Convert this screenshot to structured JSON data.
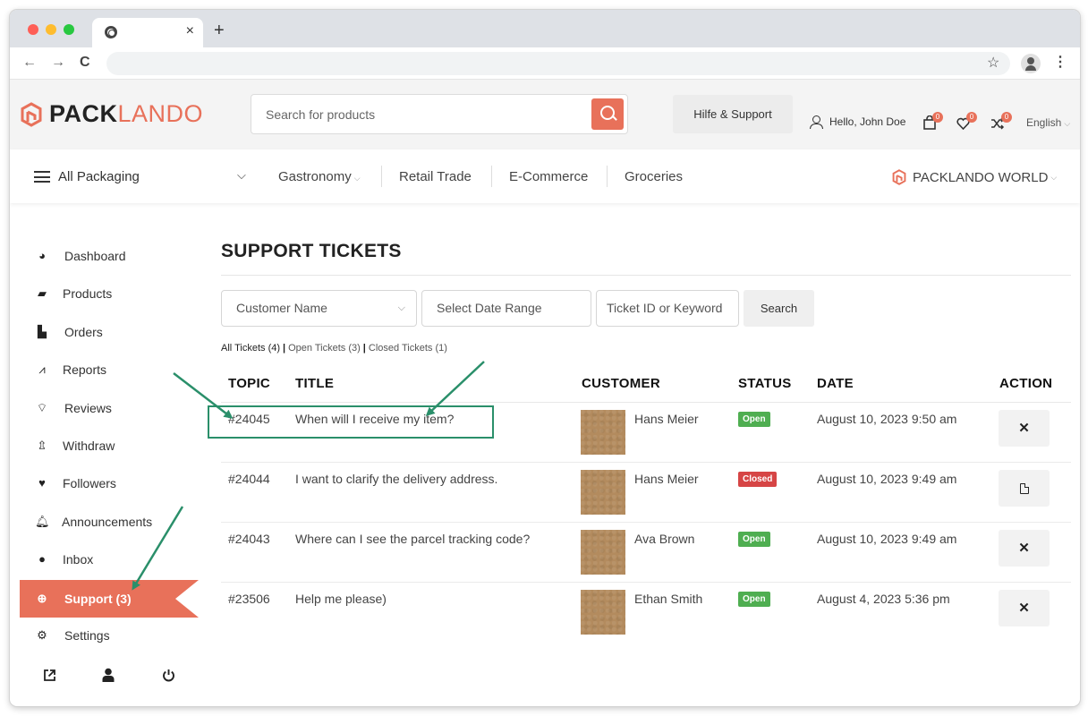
{
  "browser": {
    "tab_close": "×",
    "new_tab": "+",
    "back": "←",
    "forward": "→",
    "reload": "C",
    "bookmark_star": "☆",
    "menu": "⋮"
  },
  "header": {
    "logo_pack": "PACK",
    "logo_lando": "LANDO",
    "search_placeholder": "Search for products",
    "help_label": "Hilfe & Support",
    "user_greeting": "Hello, John Doe",
    "cart_count": "0",
    "wishlist_count": "0",
    "compare_count": "0",
    "language": "English",
    "brand_color": "#e8715a"
  },
  "catbar": {
    "all_label": "All Packaging",
    "categories": [
      "Gastronomy",
      "Retail Trade",
      "E-Commerce",
      "Groceries"
    ],
    "world_label": "PACKLANDO WORLD"
  },
  "sidebar": {
    "items": [
      {
        "label": "Dashboard",
        "icon": "gauge-icon"
      },
      {
        "label": "Products",
        "icon": "briefcase-icon"
      },
      {
        "label": "Orders",
        "icon": "cart-icon"
      },
      {
        "label": "Reports",
        "icon": "chart-icon"
      },
      {
        "label": "Reviews",
        "icon": "comments-icon"
      },
      {
        "label": "Withdraw",
        "icon": "upload-icon"
      },
      {
        "label": "Followers",
        "icon": "heart-icon"
      },
      {
        "label": "Announcements",
        "icon": "bell-icon"
      },
      {
        "label": "Inbox",
        "icon": "chat-icon"
      },
      {
        "label": "Support (3)",
        "icon": "lifebuoy-icon",
        "active": true
      },
      {
        "label": "Settings",
        "icon": "gear-icon"
      }
    ]
  },
  "main": {
    "title": "SUPPORT TICKETS",
    "filters": {
      "customer": "Customer Name",
      "date_range": "Select Date Range",
      "keyword": "Ticket ID or Keyword",
      "search_btn": "Search"
    },
    "ticket_tabs": {
      "all": "All Tickets (4)",
      "open": "Open Tickets (3)",
      "closed": "Closed Tickets (1)"
    },
    "columns": [
      "TOPIC",
      "TITLE",
      "CUSTOMER",
      "STATUS",
      "DATE",
      "ACTION"
    ],
    "rows": [
      {
        "topic": "#24045",
        "title": "When will I receive my item?",
        "customer": "Hans Meier",
        "status": "Open",
        "date": "August 10, 2023 9:50 am",
        "action": "close"
      },
      {
        "topic": "#24044",
        "title": "I want to clarify the delivery address.",
        "customer": "Hans Meier",
        "status": "Closed",
        "date": "August 10, 2023 9:49 am",
        "action": "document"
      },
      {
        "topic": "#24043",
        "title": "Where can I see the parcel tracking code?",
        "customer": "Ava Brown",
        "status": "Open",
        "date": "August 10, 2023 9:49 am",
        "action": "close"
      },
      {
        "topic": "#23506",
        "title": "Help me please)",
        "customer": "Ethan Smith",
        "status": "Open",
        "date": "August 4, 2023 5:36 pm",
        "action": "close"
      }
    ],
    "status_colors": {
      "open": "#4fae51",
      "closed": "#d64545"
    }
  }
}
